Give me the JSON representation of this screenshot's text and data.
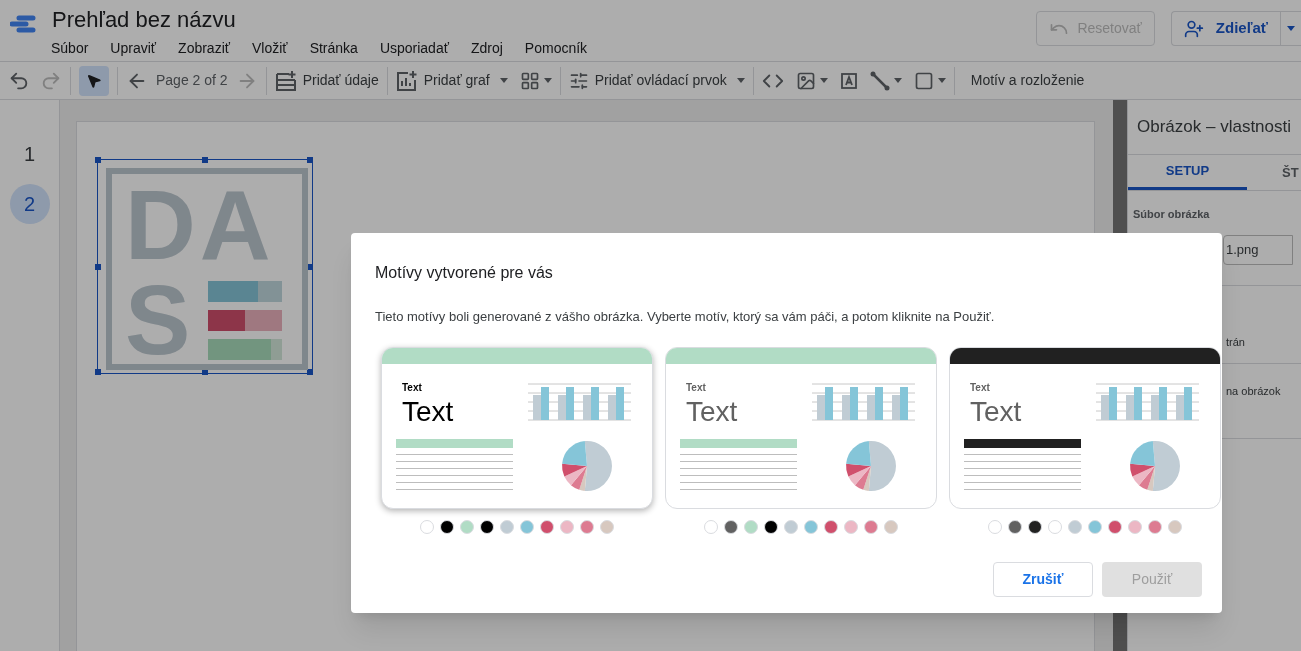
{
  "app": {
    "title": "Prehľad bez názvu",
    "menu": [
      "Súbor",
      "Upraviť",
      "Zobraziť",
      "Vložiť",
      "Stránka",
      "Usporiadať",
      "Zdroj",
      "Pomocník"
    ],
    "reset_button": {
      "label": "Resetovať",
      "disabled": true
    },
    "share_button": {
      "label": "Zdieľať"
    }
  },
  "toolbar": {
    "select_tool": {
      "selected": true
    },
    "page_indicator": "Page 2 of 2",
    "add_data": "Pridať údaje",
    "add_chart": "Pridať graf",
    "add_control": "Pridať ovládací prvok",
    "theme_layout": "Motív a rozloženie"
  },
  "pages": [
    {
      "label": "1",
      "selected": false
    },
    {
      "label": "2",
      "selected": true
    }
  ],
  "canvas_image": {
    "selected": true,
    "letters": [
      "DA",
      "S"
    ]
  },
  "properties_panel": {
    "title": "Obrázok – vlastnosti",
    "tabs": [
      {
        "label": "SETUP",
        "selected": true
      },
      {
        "label": "ŠT",
        "selected": false
      }
    ],
    "file_label": "Súbor obrázka",
    "file_name": "1.png",
    "option_1": "trán",
    "option_2": "na obrázok"
  },
  "dialog": {
    "title": "Motívy vytvorené pre vás",
    "description": "Tieto motívy boli generované z vášho obrázka. Vyberte motív, ktorý sa vám páči, a potom kliknite na Použiť.",
    "themes": [
      {
        "selected": true,
        "label": "Text",
        "heading": "Text",
        "swatches": [
          {
            "color": "#ffffff"
          },
          {
            "color": "#000000"
          },
          {
            "color": "#b1dcc5"
          },
          {
            "color": "#000000"
          },
          {
            "color": "#c0ccd4"
          },
          {
            "color": "#85c5d8"
          },
          {
            "color": "#d04f6c"
          },
          {
            "color": "#ecb7c4"
          },
          {
            "color": "#dd7b91"
          },
          {
            "color": "#d7c8bf"
          }
        ]
      },
      {
        "selected": false,
        "label": "Text",
        "heading": "Text",
        "swatches": [
          {
            "color": "#ffffff"
          },
          {
            "color": "#616161"
          },
          {
            "color": "#b1dcc5"
          },
          {
            "color": "#000000"
          },
          {
            "color": "#c0ccd4"
          },
          {
            "color": "#85c5d8"
          },
          {
            "color": "#d04f6c"
          },
          {
            "color": "#ecb7c4"
          },
          {
            "color": "#dd7b91"
          },
          {
            "color": "#d7c8bf"
          }
        ]
      },
      {
        "selected": false,
        "label": "Text",
        "heading": "Text",
        "swatches": [
          {
            "color": "#ffffff"
          },
          {
            "color": "#616161"
          },
          {
            "color": "#212121"
          },
          {
            "color": "#ffffff"
          },
          {
            "color": "#c0ccd4"
          },
          {
            "color": "#85c5d8"
          },
          {
            "color": "#d04f6c"
          },
          {
            "color": "#ecb7c4"
          },
          {
            "color": "#dd7b91"
          },
          {
            "color": "#d7c8bf"
          }
        ]
      }
    ],
    "cancel_button": "Zrušiť",
    "apply_button": {
      "label": "Použiť",
      "disabled": true
    }
  }
}
